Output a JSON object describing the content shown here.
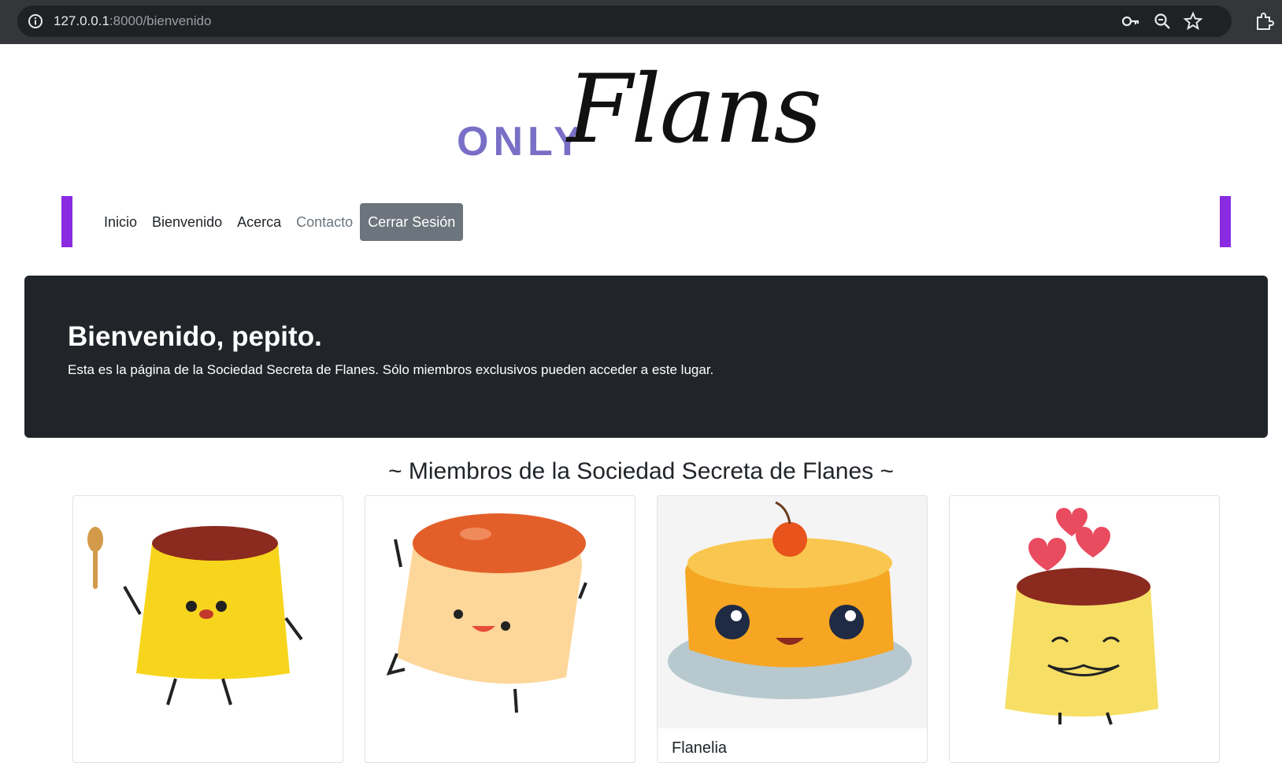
{
  "browser": {
    "url_host": "127.0.0.1",
    "url_path": ":8000/bienvenido",
    "icons": [
      "info-icon",
      "key-icon",
      "zoom-icon",
      "star-icon",
      "extensions-icon"
    ]
  },
  "logo": {
    "only": "ONLY",
    "flans": "Flans"
  },
  "nav": {
    "items": [
      {
        "label": "Inicio"
      },
      {
        "label": "Bienvenido"
      },
      {
        "label": "Acerca"
      },
      {
        "label": "Contacto"
      }
    ],
    "logout_label": "Cerrar Sesión",
    "accent_color": "#8a2be2"
  },
  "hero": {
    "title": "Bienvenido, pepito.",
    "text": "Esta es la página de la Sociedad Secreta de Flanes. Sólo miembros exclusivos pueden acceder a este lugar."
  },
  "members": {
    "heading": "~ Miembros de la Sociedad Secreta de Flanes ~",
    "cards": [
      {
        "title": "",
        "image": "flan-with-spoon"
      },
      {
        "title": "",
        "image": "flan-dancing"
      },
      {
        "title": "Flanelia",
        "image": "flan-cherry-cake"
      },
      {
        "title": "",
        "image": "flan-hearts"
      }
    ]
  }
}
